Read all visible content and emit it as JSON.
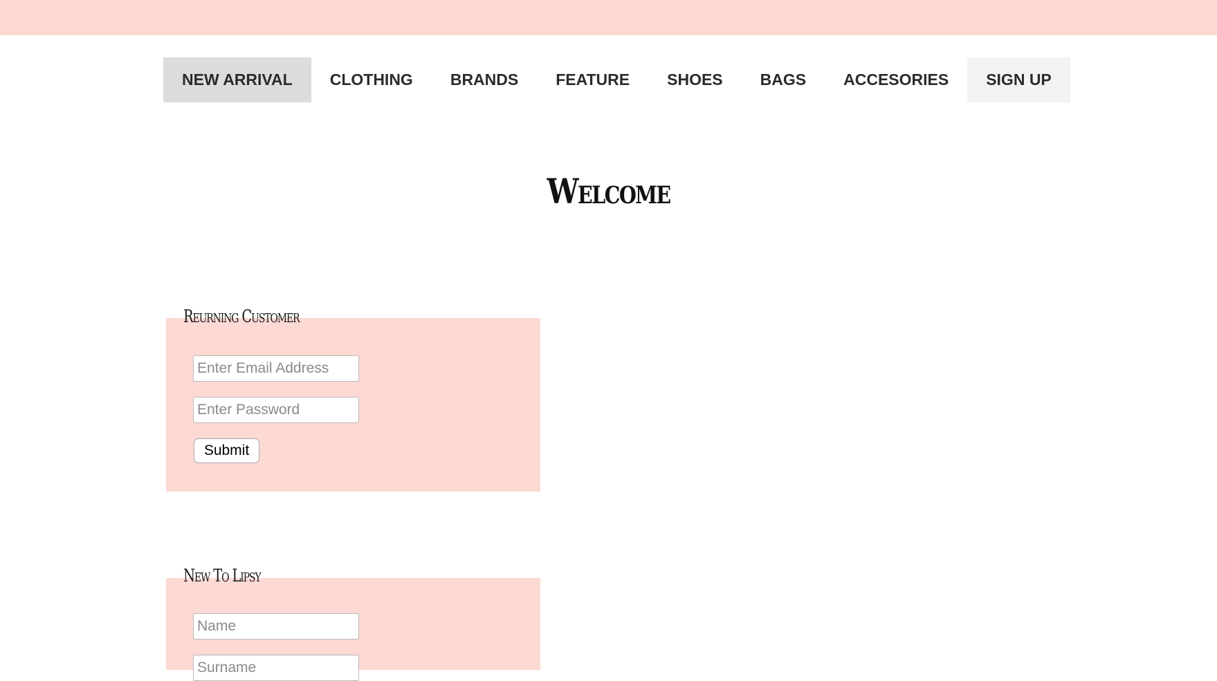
{
  "nav": {
    "items": [
      {
        "label": "NEW ARRIVAL",
        "state": "active"
      },
      {
        "label": "CLOTHING"
      },
      {
        "label": "BRANDS"
      },
      {
        "label": "FEATURE"
      },
      {
        "label": "SHOES"
      },
      {
        "label": "BAGS"
      },
      {
        "label": "ACCESORIES"
      },
      {
        "label": "SIGN UP",
        "state": "highlighted"
      }
    ]
  },
  "page": {
    "title": "Welcome"
  },
  "returning_customer": {
    "label": "Reurning Customer",
    "email_placeholder": "Enter Email Address",
    "password_placeholder": "Enter Password",
    "submit_label": "Submit"
  },
  "new_customer": {
    "label": "New To Lipsy",
    "name_placeholder": "Name",
    "surname_placeholder": "Surname"
  },
  "colors": {
    "banner": "#fdd9d4",
    "panel": "#fdd9d4",
    "nav_active": "#dcdcdc",
    "nav_signup": "#f3f3f3"
  }
}
